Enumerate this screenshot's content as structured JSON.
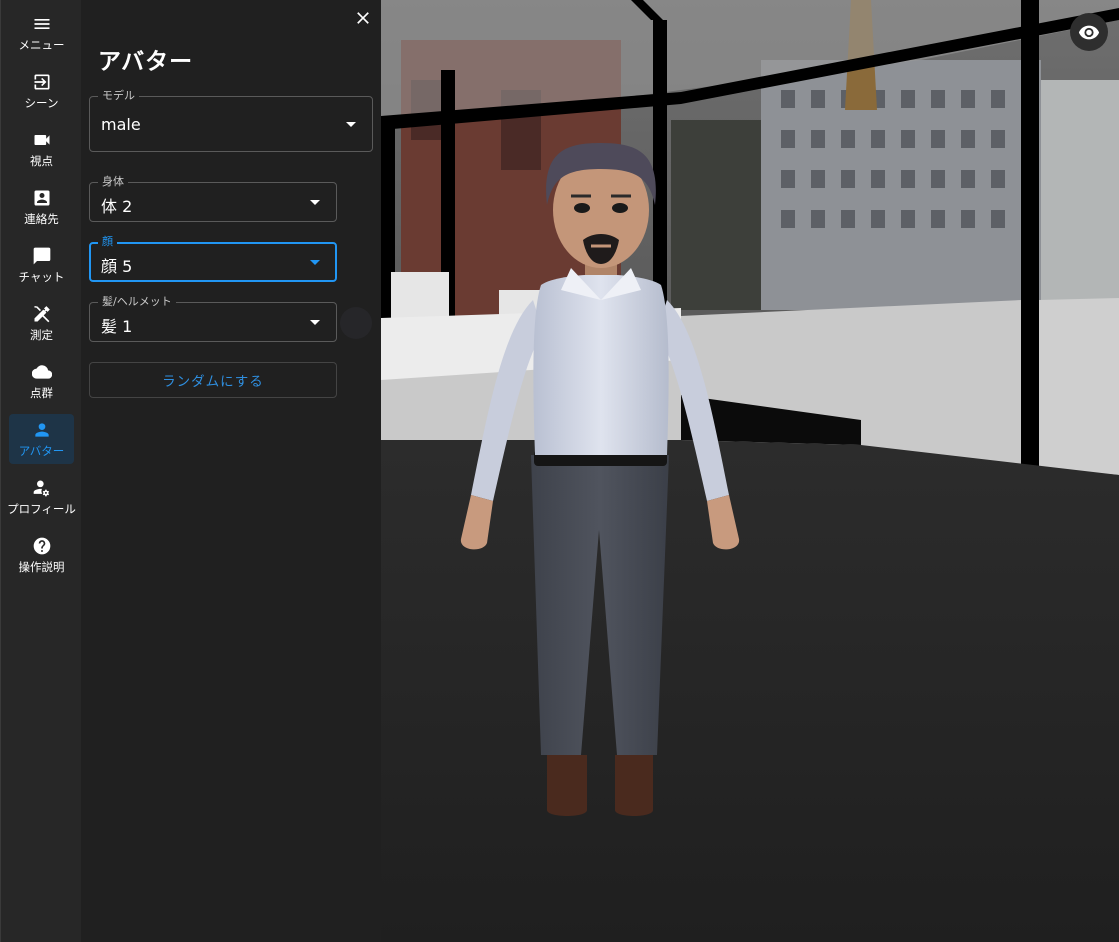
{
  "rail": {
    "items": [
      {
        "label": "メニュー",
        "icon": "menu-icon"
      },
      {
        "label": "シーン",
        "icon": "login-icon"
      },
      {
        "label": "視点",
        "icon": "videocam-icon"
      },
      {
        "label": "連絡先",
        "icon": "contact-icon"
      },
      {
        "label": "チャット",
        "icon": "chat-icon"
      },
      {
        "label": "測定",
        "icon": "ruler-pencil-icon"
      },
      {
        "label": "点群",
        "icon": "cloud-icon"
      },
      {
        "label": "アバター",
        "icon": "person-icon",
        "active": true
      },
      {
        "label": "プロフィール",
        "icon": "person-gear-icon"
      },
      {
        "label": "操作説明",
        "icon": "help-icon"
      }
    ]
  },
  "panel": {
    "title": "アバター",
    "fields": {
      "model": {
        "label": "モデル",
        "value": "male"
      },
      "body": {
        "label": "身体",
        "value": "体 2"
      },
      "face": {
        "label": "顔",
        "value": "顔 5"
      },
      "hair": {
        "label": "髪/ヘルメット",
        "value": "髪 1"
      }
    },
    "random_button": "ランダムにする"
  },
  "colors": {
    "accent": "#2196f3",
    "rail_bg": "#272727",
    "panel_bg": "#202020"
  }
}
